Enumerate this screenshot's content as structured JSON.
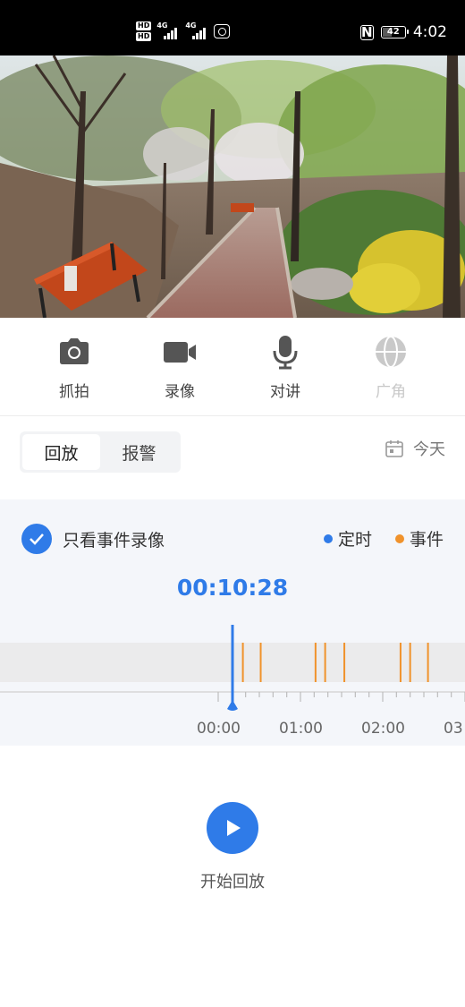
{
  "status_bar": {
    "time": "4:02",
    "battery": "42",
    "hd_badge": "HD",
    "network": "4G",
    "nfc": "N"
  },
  "toolbar": {
    "capture": "抓拍",
    "record": "录像",
    "talk": "对讲",
    "wide_angle": "广角"
  },
  "tabs": {
    "playback": "回放",
    "alarm": "报警"
  },
  "date_label": "今天",
  "filter_label": "只看事件录像",
  "legend": {
    "scheduled": "定时",
    "event": "事件",
    "scheduled_color": "#2f7be8",
    "event_color": "#f0922b"
  },
  "current_time": "00:10:28",
  "timeline": {
    "tick_labels": [
      "00:00",
      "01:00",
      "02:00",
      "03"
    ],
    "event_marks_minutes": [
      18,
      31,
      71,
      78,
      92,
      133,
      140,
      153
    ]
  },
  "play_label": "开始回放"
}
